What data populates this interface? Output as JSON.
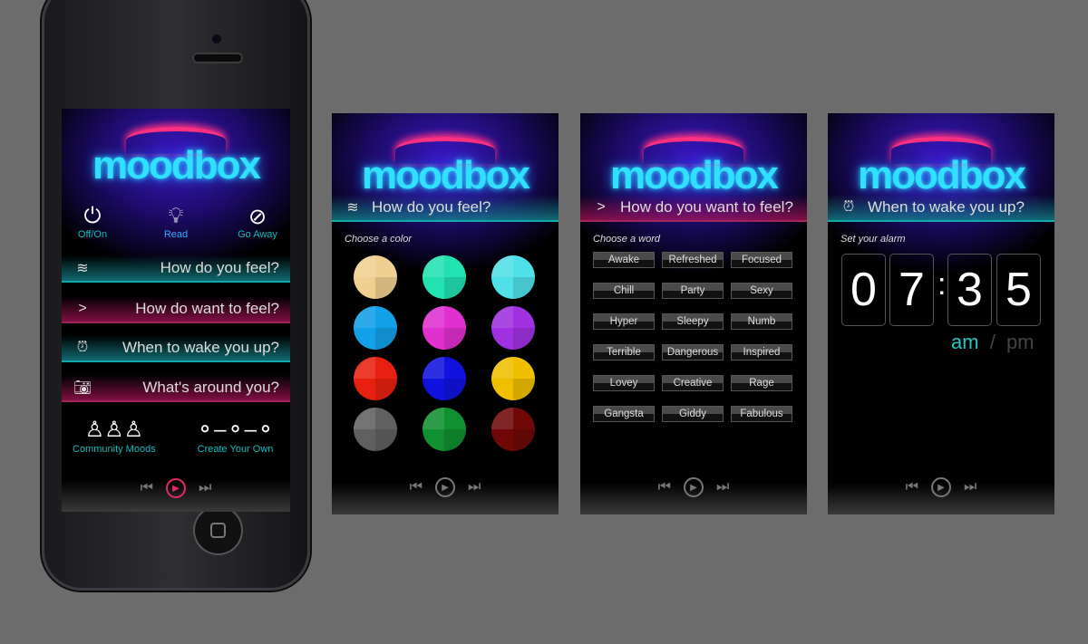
{
  "logo": "moodbox",
  "home": {
    "quick_actions": [
      {
        "label": "Off/On",
        "icon": "power-icon"
      },
      {
        "label": "Read",
        "icon": "lightbulb-icon"
      },
      {
        "label": "Go Away",
        "icon": "block-icon"
      }
    ],
    "menu": [
      {
        "label": "How do you feel?",
        "icon": "waves-icon"
      },
      {
        "label": "How do want to feel?",
        "icon": "chevron-right-icon"
      },
      {
        "label": "When to wake you up?",
        "icon": "alarm-clock-icon"
      },
      {
        "label": "What's around you?",
        "icon": "camera-icon"
      }
    ],
    "bottom": [
      {
        "label": "Community Moods",
        "icon": "people-icon"
      },
      {
        "label": "Create Your Own",
        "icon": "nodes-icon"
      }
    ]
  },
  "color_screen": {
    "header": "How do you feel?",
    "label": "Choose a color",
    "colors": [
      "#efd090",
      "#22e2b0",
      "#50e0e8",
      "#12a0e8",
      "#e030d0",
      "#a030e0",
      "#e82010",
      "#1212e0",
      "#f0c000",
      "#606060",
      "#109030",
      "#700808"
    ]
  },
  "word_screen": {
    "header": "How do you want to feel?",
    "label": "Choose a word",
    "words": [
      "Awake",
      "Refreshed",
      "Focused",
      "Chill",
      "Party",
      "Sexy",
      "Hyper",
      "Sleepy",
      "Numb",
      "Terrible",
      "Dangerous",
      "Inspired",
      "Lovey",
      "Creative",
      "Rage",
      "Gangsta",
      "Giddy",
      "Fabulous"
    ]
  },
  "alarm_screen": {
    "header": "When to wake you up?",
    "label": "Set your alarm",
    "digits": [
      "0",
      "7",
      "3",
      "5"
    ],
    "separator": ":",
    "am": "am",
    "slash": "/",
    "pm": "pm",
    "selected": "am"
  },
  "colors": {
    "teal": "#1bb",
    "pink": "#e8266e",
    "accent_active": "#20c8c8"
  }
}
